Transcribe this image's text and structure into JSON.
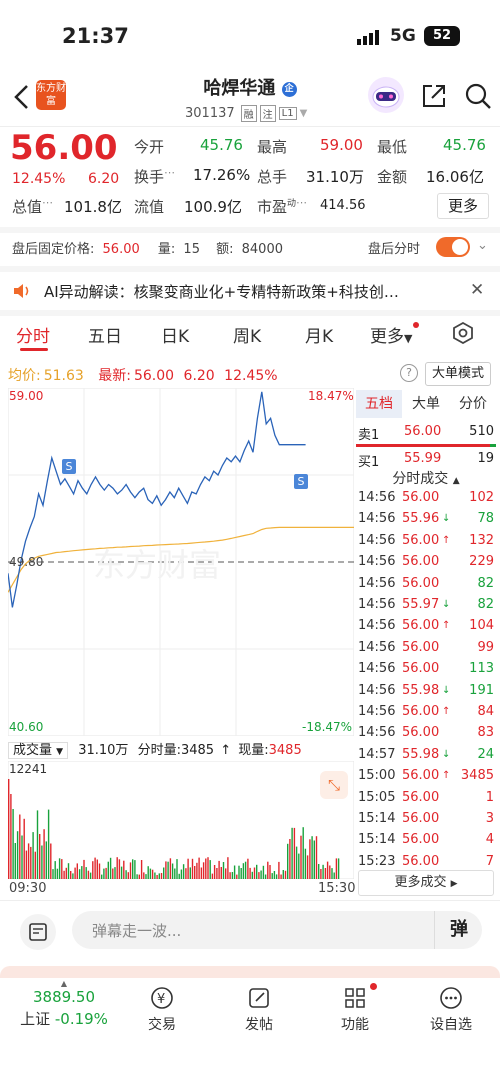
{
  "status": {
    "time": "21:37",
    "network": "5G",
    "battery": "52"
  },
  "header": {
    "brand_logo_text": "东方财富",
    "stock_name": "哈焊华通",
    "stock_code": "301137",
    "tags": [
      "融",
      "注",
      "L1"
    ]
  },
  "quote": {
    "price": "56.00",
    "change_pct": "12.45%",
    "change_amt": "6.20",
    "fields": [
      {
        "label": "今开",
        "value": "45.76"
      },
      {
        "label": "最高",
        "value": "59.00"
      },
      {
        "label": "最低",
        "value": "45.76"
      },
      {
        "label": "换手",
        "value": "17.26%"
      },
      {
        "label": "总手",
        "value": "31.10万"
      },
      {
        "label": "金额",
        "value": "16.06亿"
      },
      {
        "label": "总值",
        "value": "101.8亿"
      },
      {
        "label": "流值",
        "value": "100.9亿"
      },
      {
        "label": "市盈",
        "sup": "动",
        "value": "414.56"
      }
    ],
    "more_label": "更多"
  },
  "afterhours": {
    "price_label": "盘后固定价格:",
    "price": "56.00",
    "vol_label": "量:",
    "vol": "15",
    "amt_label": "额:",
    "amt": "84000",
    "minute_label": "盘后分时"
  },
  "ai_banner": {
    "text": "AI异动解读：核聚变商业化+专精特新政策+科技创…"
  },
  "tabs": [
    "分时",
    "五日",
    "日K",
    "周K",
    "月K",
    "更多"
  ],
  "chart_header": {
    "avg_label": "均价:",
    "avg_value": "51.63",
    "latest_label": "最新:",
    "latest_value": "56.00",
    "latest_chg": "6.20",
    "latest_pct": "12.45%",
    "bigorder_label": "大单模式"
  },
  "chart_data": {
    "type": "line",
    "ylim": [
      40.6,
      59.0
    ],
    "ref_price": 49.8,
    "y_labels": {
      "top": "59.00",
      "mid": "49.80",
      "bottom": "40.60",
      "top_pct": "18.47%",
      "bottom_pct": "-18.47%"
    },
    "x_labels": [
      "09:30",
      "15:30"
    ],
    "price": [
      49.2,
      47.4,
      48.6,
      49.9,
      50.9,
      51.6,
      52.2,
      53.4,
      52.8,
      54.1,
      55.3,
      54.6,
      53.9,
      54.2,
      53.8,
      53.4,
      54.1,
      53.7,
      53.4,
      53.9,
      54.3,
      53.9,
      53.6,
      53.9,
      53.7,
      53.4,
      53.6,
      53.9,
      53.5,
      53.2,
      53.5,
      53.7,
      53.1,
      52.9,
      53.3,
      52.8,
      53.1,
      53.5,
      53.2,
      53.7,
      53.3,
      52.9,
      53.5,
      53.4,
      53.9,
      54.3,
      54.1,
      54.6,
      54.4,
      54.9,
      55.3,
      55.1,
      55.4,
      55.1,
      55.7,
      56.2,
      55.6,
      57.4,
      58.8,
      57.1,
      57.4,
      56.5,
      56.0,
      56.0,
      56.0,
      56.0,
      56.0,
      56.0,
      56.0
    ],
    "avg": [
      48.2,
      48.6,
      49.0,
      49.4,
      49.7,
      49.9,
      50.0,
      50.1,
      50.15,
      50.2,
      50.25,
      50.3,
      50.32,
      50.35,
      50.37,
      50.4,
      50.42,
      50.44,
      50.46,
      50.48,
      50.5,
      50.52,
      50.53,
      50.55,
      50.56,
      50.58,
      50.59,
      50.6,
      50.62,
      50.63,
      50.64,
      50.66,
      50.67,
      50.68,
      50.7,
      50.71,
      50.72,
      50.73,
      50.74,
      50.75,
      50.77,
      50.78,
      50.8,
      50.82,
      50.84,
      50.86,
      50.88,
      50.9,
      50.93,
      50.96,
      51.0,
      51.05,
      51.1,
      51.15,
      51.2,
      51.25,
      51.3,
      51.42,
      51.52,
      51.58,
      51.6,
      51.62,
      51.63,
      51.63,
      51.63,
      51.63,
      51.63,
      51.63,
      51.63
    ],
    "markers": [
      "S",
      "S"
    ]
  },
  "volume": {
    "label": "成交量",
    "total": "31.10万",
    "minute_label": "分时量:",
    "minute_value": "3485",
    "now_label": "现量:",
    "now_value": "3485",
    "max": "12241"
  },
  "order_book": {
    "tabs": [
      "五档",
      "大单",
      "分价"
    ],
    "sell": {
      "label": "卖1",
      "price": "56.00",
      "vol": "510"
    },
    "buy": {
      "label": "买1",
      "price": "55.99",
      "vol": "19"
    },
    "trades_title": "分时成交",
    "trades": [
      {
        "t": "14:56",
        "p": "56.00",
        "d": "",
        "v": "102",
        "c": "r"
      },
      {
        "t": "14:56",
        "p": "55.96",
        "d": "↓",
        "v": "78",
        "c": "g"
      },
      {
        "t": "14:56",
        "p": "56.00",
        "d": "↑",
        "v": "132",
        "c": "r"
      },
      {
        "t": "14:56",
        "p": "56.00",
        "d": "",
        "v": "229",
        "c": "r"
      },
      {
        "t": "14:56",
        "p": "56.00",
        "d": "",
        "v": "82",
        "c": "g"
      },
      {
        "t": "14:56",
        "p": "55.97",
        "d": "↓",
        "v": "82",
        "c": "g"
      },
      {
        "t": "14:56",
        "p": "56.00",
        "d": "↑",
        "v": "104",
        "c": "r"
      },
      {
        "t": "14:56",
        "p": "56.00",
        "d": "",
        "v": "99",
        "c": "r"
      },
      {
        "t": "14:56",
        "p": "56.00",
        "d": "",
        "v": "113",
        "c": "g"
      },
      {
        "t": "14:56",
        "p": "55.98",
        "d": "↓",
        "v": "191",
        "c": "g"
      },
      {
        "t": "14:56",
        "p": "56.00",
        "d": "↑",
        "v": "84",
        "c": "r"
      },
      {
        "t": "14:56",
        "p": "56.00",
        "d": "",
        "v": "83",
        "c": "r"
      },
      {
        "t": "14:57",
        "p": "55.98",
        "d": "↓",
        "v": "24",
        "c": "g"
      },
      {
        "t": "15:00",
        "p": "56.00",
        "d": "↑",
        "v": "3485",
        "c": "r"
      },
      {
        "t": "15:05",
        "p": "56.00",
        "d": "",
        "v": "1",
        "c": "r"
      },
      {
        "t": "15:14",
        "p": "56.00",
        "d": "",
        "v": "3",
        "c": "r"
      },
      {
        "t": "15:14",
        "p": "56.00",
        "d": "",
        "v": "4",
        "c": "r"
      },
      {
        "t": "15:23",
        "p": "56.00",
        "d": "",
        "v": "7",
        "c": "r"
      }
    ],
    "more_trades": "更多成交"
  },
  "comment": {
    "placeholder": "弹幕走一波...",
    "danmu_label": "弹"
  },
  "bottom_nav": {
    "index_value": "3889.50",
    "index_name": "上证",
    "index_pct": "-0.19%",
    "items": [
      "交易",
      "发帖",
      "功能",
      "设自选"
    ]
  }
}
